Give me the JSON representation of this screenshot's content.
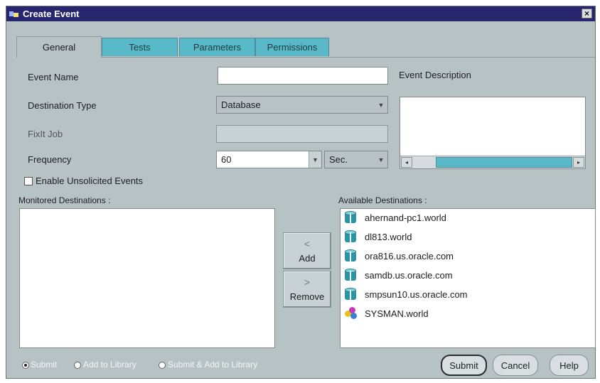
{
  "window": {
    "title": "Create Event"
  },
  "tabs": [
    {
      "label": "General",
      "active": true
    },
    {
      "label": "Tests"
    },
    {
      "label": "Parameters"
    },
    {
      "label": "Permissions"
    }
  ],
  "general": {
    "event_name_label": "Event Name",
    "event_name_value": "",
    "event_description_label": "Event Description",
    "destination_type_label": "Destination Type",
    "destination_type_value": "Database",
    "fixit_job_label": "FixIt Job",
    "frequency_label": "Frequency",
    "frequency_value": "60",
    "frequency_unit": "Sec.",
    "enable_unsolicited_label": "Enable Unsolicited Events",
    "enable_unsolicited_checked": false
  },
  "monitored": {
    "label": "Monitored Destinations :",
    "items": []
  },
  "available": {
    "label": "Available Destinations :",
    "items": [
      {
        "name": "ahernand-pc1.world",
        "icon": "database-icon"
      },
      {
        "name": "dl813.world",
        "icon": "database-icon"
      },
      {
        "name": "ora816.us.oracle.com",
        "icon": "database-icon"
      },
      {
        "name": "samdb.us.oracle.com",
        "icon": "database-icon"
      },
      {
        "name": "smpsun10.us.oracle.com",
        "icon": "database-icon"
      },
      {
        "name": "SYSMAN.world",
        "icon": "sysman-group-icon"
      }
    ]
  },
  "transfer": {
    "add_label": "Add",
    "remove_label": "Remove"
  },
  "footer": {
    "options": [
      {
        "label": "Submit",
        "checked": true
      },
      {
        "label": "Add to Library",
        "checked": false
      },
      {
        "label": "Submit & Add to Library",
        "checked": false
      }
    ],
    "submit_label": "Submit",
    "cancel_label": "Cancel",
    "help_label": "Help"
  }
}
